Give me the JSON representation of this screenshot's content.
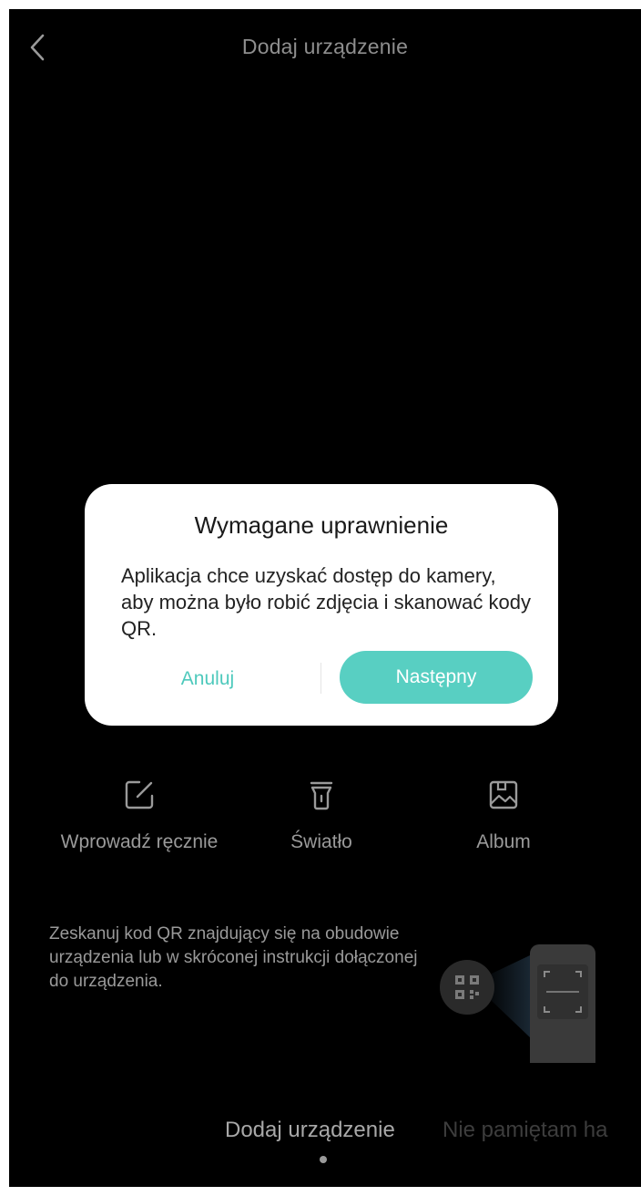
{
  "header": {
    "title": "Dodaj urządzenie",
    "back_icon": "chevron-left-icon"
  },
  "dialog": {
    "title": "Wymagane uprawnienie",
    "message": "Aplikacja chce uzyskać dostęp do kamery, aby można było robić zdjęcia i skanować kody QR.",
    "cancel_label": "Anuluj",
    "next_label": "Następny"
  },
  "tools": [
    {
      "label": "Wprowadź ręcznie",
      "icon": "edit-icon"
    },
    {
      "label": "Światło",
      "icon": "flashlight-icon"
    },
    {
      "label": "Album",
      "icon": "album-icon"
    }
  ],
  "instructions": "Zeskanuj kod QR znajdujący się na obudowie urządzenia lub w skróconej instrukcji dołączonej do urządzenia.",
  "bottom_tabs": [
    {
      "label": "Dodaj urządzenie",
      "active": true
    },
    {
      "label": "Nie pamiętam ha",
      "active": false
    }
  ],
  "colors": {
    "accent": "#58cfc2",
    "accent_text": "#4ec9bc",
    "background": "#000000",
    "dialog_bg": "#ffffff",
    "muted_text": "#9a9a9a"
  }
}
